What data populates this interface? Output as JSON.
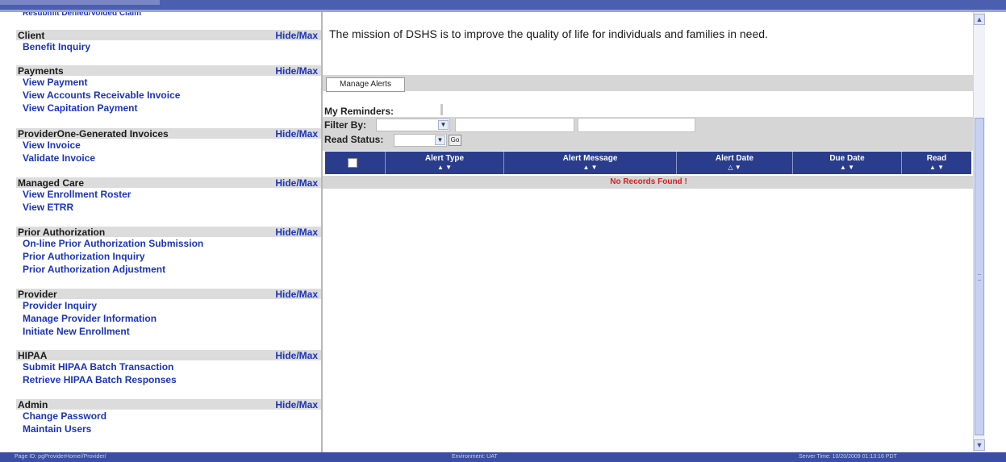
{
  "mission": "The mission of DSHS is to improve the quality of life for individuals and families in need.",
  "sidebar": {
    "hide_max_label": "Hide/Max",
    "top_cut_link": "Resubmit Denied/Voided Claim",
    "sections": [
      {
        "title": "Client",
        "links": [
          "Benefit Inquiry"
        ]
      },
      {
        "title": "Payments",
        "links": [
          "View Payment",
          "View Accounts Receivable Invoice",
          "View Capitation Payment"
        ]
      },
      {
        "title": "ProviderOne-Generated Invoices",
        "links": [
          "View Invoice",
          "Validate Invoice"
        ]
      },
      {
        "title": "Managed Care",
        "links": [
          "View Enrollment Roster",
          "View ETRR"
        ]
      },
      {
        "title": "Prior Authorization",
        "links": [
          "On-line Prior Authorization Submission",
          "Prior Authorization Inquiry",
          "Prior Authorization Adjustment"
        ]
      },
      {
        "title": "Provider",
        "links": [
          "Provider Inquiry",
          "Manage Provider Information",
          "Initiate New Enrollment"
        ]
      },
      {
        "title": "HIPAA",
        "links": [
          "Submit HIPAA Batch Transaction",
          "Retrieve HIPAA Batch Responses"
        ]
      },
      {
        "title": "Admin",
        "links": [
          "Change Password",
          "Maintain Users"
        ]
      }
    ]
  },
  "alerts": {
    "manage_alerts_button": "Manage Alerts",
    "my_reminders_label": "My Reminders:",
    "filter_by_label": "Filter By:",
    "read_status_label": "Read Status:",
    "go_button": "Go",
    "columns": [
      {
        "label": "Alert Type",
        "sort": "▲ ▼"
      },
      {
        "label": "Alert Message",
        "sort": "▲ ▼"
      },
      {
        "label": "Alert Date",
        "sort": "△ ▼"
      },
      {
        "label": "Due Date",
        "sort": "▲ ▼"
      },
      {
        "label": "Read",
        "sort": "▲ ▼"
      }
    ],
    "no_records": "No Records Found !"
  },
  "status_bar": {
    "left": "Page ID: pgProviderHome//Provider/",
    "center": "Environment: UAT",
    "right": "Server Time: 10/20/2009 01:13:16 PDT"
  },
  "colors": {
    "link": "#1b34b8",
    "grid_header": "#2a3d8c",
    "no_records": "#d42020",
    "frame": "#4a5fb0"
  },
  "icons": {
    "scroll_up": "▲",
    "scroll_down": "▼",
    "dropdown": "▼"
  }
}
